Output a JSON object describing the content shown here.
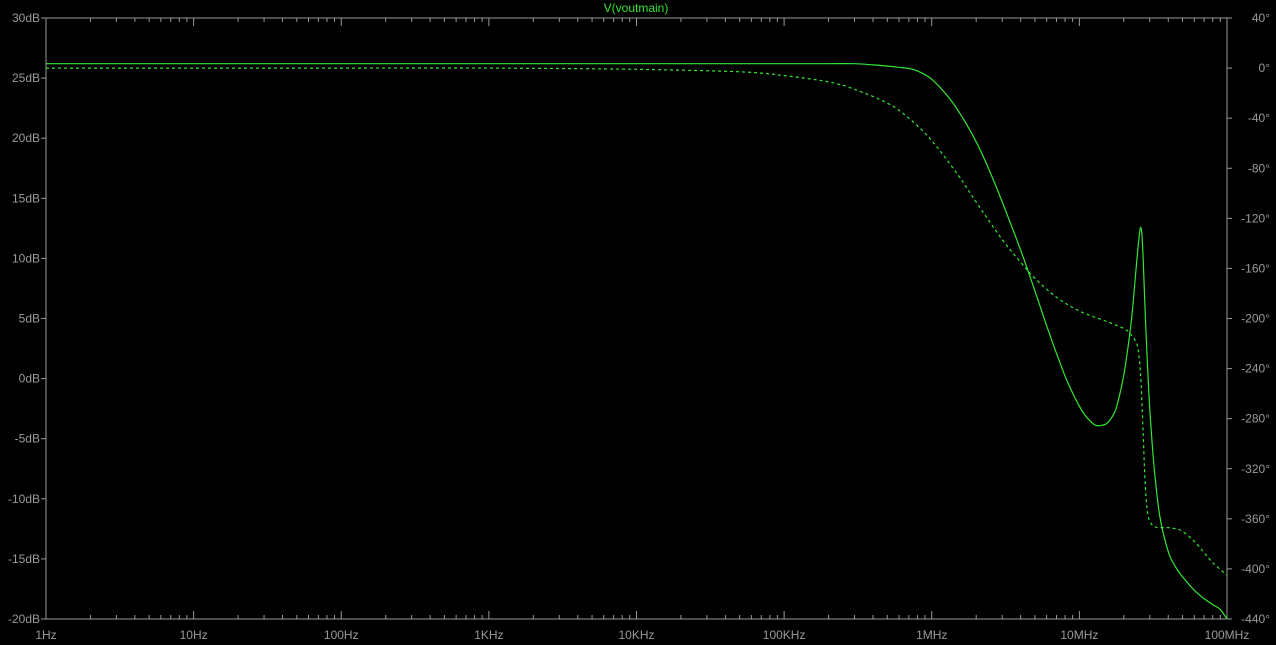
{
  "chart_data": {
    "type": "line",
    "title": "V(voutmain)",
    "x_scale": "log",
    "xlim": [
      1,
      100000000
    ],
    "x_ticks": [
      {
        "v": 1,
        "label": "1Hz"
      },
      {
        "v": 10,
        "label": "10Hz"
      },
      {
        "v": 100,
        "label": "100Hz"
      },
      {
        "v": 1000,
        "label": "1KHz"
      },
      {
        "v": 10000,
        "label": "10KHz"
      },
      {
        "v": 100000,
        "label": "100KHz"
      },
      {
        "v": 1000000,
        "label": "1MHz"
      },
      {
        "v": 10000000,
        "label": "10MHz"
      },
      {
        "v": 100000000,
        "label": "100MHz"
      }
    ],
    "ylim_left": [
      -20,
      30
    ],
    "y_ticks_left": [
      {
        "v": 30,
        "label": "30dB"
      },
      {
        "v": 25,
        "label": "25dB"
      },
      {
        "v": 20,
        "label": "20dB"
      },
      {
        "v": 15,
        "label": "15dB"
      },
      {
        "v": 10,
        "label": "10dB"
      },
      {
        "v": 5,
        "label": "5dB"
      },
      {
        "v": 0,
        "label": "0dB"
      },
      {
        "v": -5,
        "label": "-5dB"
      },
      {
        "v": -10,
        "label": "-10dB"
      },
      {
        "v": -15,
        "label": "-15dB"
      },
      {
        "v": -20,
        "label": "-20dB"
      }
    ],
    "ylim_right": [
      -440,
      40
    ],
    "y_ticks_right": [
      {
        "v": 40,
        "label": "40°"
      },
      {
        "v": 0,
        "label": "0°"
      },
      {
        "v": -40,
        "label": "-40°"
      },
      {
        "v": -80,
        "label": "-80°"
      },
      {
        "v": -120,
        "label": "-120°"
      },
      {
        "v": -160,
        "label": "-160°"
      },
      {
        "v": -200,
        "label": "-200°"
      },
      {
        "v": -240,
        "label": "-240°"
      },
      {
        "v": -280,
        "label": "-280°"
      },
      {
        "v": -320,
        "label": "-320°"
      },
      {
        "v": -360,
        "label": "-360°"
      },
      {
        "v": -400,
        "label": "-400°"
      },
      {
        "v": -440,
        "label": "-440°"
      }
    ],
    "grid": false,
    "colors": {
      "background": "#000000",
      "frame": "#9a9a9a",
      "text": "#9a9a9a",
      "trace": "#33e633"
    },
    "series": [
      {
        "axis": "left",
        "style": "solid",
        "x": [
          1,
          10,
          100,
          1000,
          10000,
          100000,
          200000,
          300000,
          400000,
          500000,
          600000,
          700000,
          800000,
          1000000,
          1300000,
          1600000,
          2000000,
          2500000,
          3000000,
          4000000,
          5000000,
          6000000,
          7000000,
          8000000,
          9000000,
          10000000,
          11000000,
          12000000,
          13000000,
          14000000,
          15000000,
          16000000,
          17000000,
          18000000,
          20000000,
          22000000,
          23000000,
          24000000,
          25000000,
          25500000,
          26000000,
          26500000,
          27000000,
          27500000,
          28000000,
          29000000,
          30000000,
          32000000,
          35000000,
          40000000,
          45000000,
          50000000,
          60000000,
          70000000,
          80000000,
          90000000,
          100000000
        ],
        "y": [
          26.2,
          26.2,
          26.2,
          26.2,
          26.2,
          26.2,
          26.2,
          26.2,
          26.1,
          26.0,
          25.9,
          25.8,
          25.6,
          24.9,
          23.4,
          21.8,
          19.7,
          17.1,
          14.7,
          10.7,
          7.3,
          4.4,
          2.1,
          0.2,
          -1.2,
          -2.3,
          -3.1,
          -3.6,
          -3.9,
          -3.9,
          -3.8,
          -3.5,
          -3.0,
          -2.2,
          0.3,
          3.8,
          6.0,
          8.6,
          11.0,
          12.0,
          12.6,
          12.0,
          10.1,
          7.7,
          5.0,
          0.9,
          -2.6,
          -7.2,
          -11.4,
          -14.4,
          -15.7,
          -16.5,
          -17.6,
          -18.3,
          -18.8,
          -19.2,
          -20.0
        ]
      },
      {
        "axis": "right",
        "style": "dashed",
        "x": [
          1,
          10,
          100,
          1000,
          10000,
          50000,
          100000,
          200000,
          300000,
          500000,
          700000,
          1000000,
          1500000,
          2000000,
          3000000,
          4000000,
          5000000,
          7000000,
          10000000,
          15000000,
          20000000,
          22000000,
          24000000,
          25000000,
          26000000,
          27000000,
          28000000,
          29000000,
          30000000,
          32000000,
          35000000,
          40000000,
          45000000,
          50000000,
          60000000,
          70000000,
          80000000,
          100000000
        ],
        "y": [
          0,
          0,
          0,
          0,
          -1,
          -3,
          -6,
          -11,
          -17,
          -28,
          -40,
          -58,
          -85,
          -107,
          -137,
          -155,
          -168,
          -183,
          -194,
          -202,
          -208,
          -212,
          -218,
          -225,
          -245,
          -290,
          -335,
          -355,
          -362,
          -366,
          -367,
          -367,
          -368,
          -370,
          -378,
          -387,
          -395,
          -405
        ]
      }
    ]
  }
}
